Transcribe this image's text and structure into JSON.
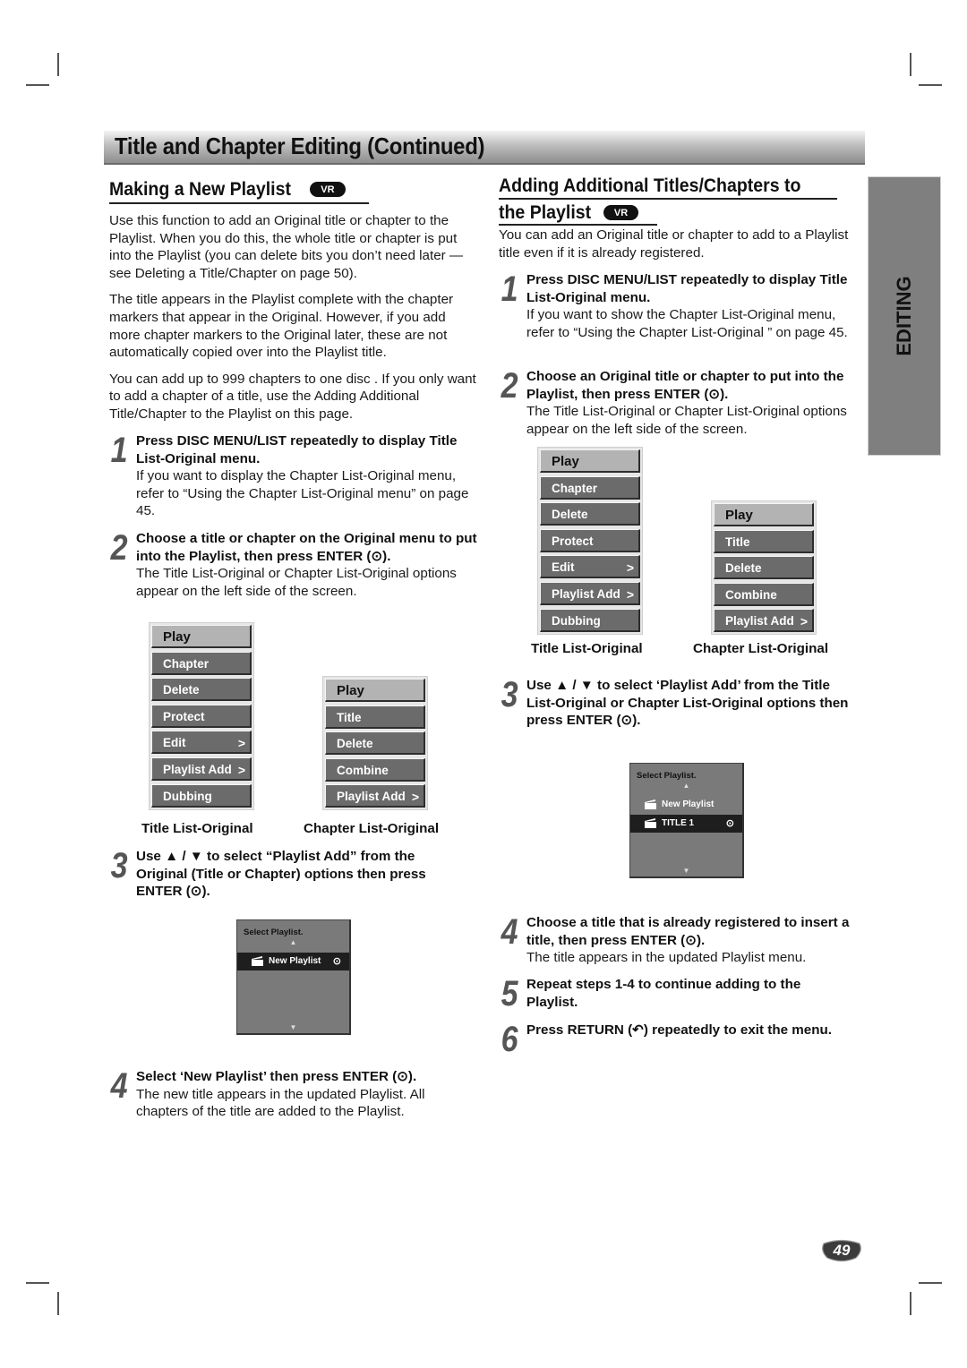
{
  "page": {
    "banner_title": "Title and Chapter Editing (Continued)",
    "side_tab": "EDITING",
    "page_number": "49"
  },
  "left": {
    "heading": "Making a New Playlist",
    "badge": "VR",
    "paragraphs": [
      "Use this function to add an Original title or chapter to the Playlist. When you do this, the whole title or chapter is put into the Playlist (you can delete bits you don’t need later — see Deleting a Title/Chapter on page 50).",
      "The title appears in the Playlist complete with the chapter markers that appear in the Original. However, if you add more chapter markers to the Original later, these are not automatically copied over into the Playlist title.",
      "You can add up to 999 chapters to one disc . If you only want to add a chapter of a title, use the Adding Additional Title/Chapter to the Playlist on this page."
    ],
    "steps": [
      {
        "num": "1",
        "bold": "Press DISC MENU/LIST repeatedly to display Title List-Original menu.",
        "normal": "If you want to display the Chapter List-Original menu, refer to “Using the Chapter List-Original menu” on page 45."
      },
      {
        "num": "2",
        "bold": "Choose a title or chapter on the Original menu to put into the Playlist, then press ENTER (⊙).",
        "normal": "The Title List-Original or Chapter List-Original options appear on the left side of the screen."
      },
      {
        "num": "3",
        "bold": "Use ▲ / ▼ to select “Playlist Add” from the Original (Title or Chapter) options then press ENTER (⊙).",
        "normal": ""
      },
      {
        "num": "4",
        "bold": "Select ‘New Playlist’ then press ENTER (⊙).",
        "normal": "The new title appears in the updated Playlist. All chapters of the title are added to the Playlist."
      }
    ],
    "title_menu": {
      "caption": "Title List-Original",
      "items": [
        "Play",
        "Chapter",
        "Delete",
        "Protect",
        "Edit",
        "Playlist Add",
        "Dubbing"
      ],
      "submenu_items": [
        "Edit",
        "Playlist Add"
      ]
    },
    "chapter_menu": {
      "caption": "Chapter List-Original",
      "items": [
        "Play",
        "Title",
        "Delete",
        "Combine",
        "Playlist Add"
      ],
      "submenu_items": [
        "Playlist Add"
      ]
    },
    "playlist_box": {
      "header": "Select Playlist.",
      "rows": [
        {
          "label": "New Playlist",
          "selected": true
        }
      ]
    }
  },
  "right": {
    "heading_line1": "Adding Additional Titles/Chapters to",
    "heading_line2": "the Playlist",
    "badge": "VR",
    "intro": "You can add an Original title or chapter to add to a Playlist title even if it is already registered.",
    "steps": [
      {
        "num": "1",
        "bold": "Press DISC MENU/LIST repeatedly to display Title List-Original menu.",
        "normal": "If you want to show the Chapter List-Original menu, refer to “Using the Chapter List-Original ” on page 45."
      },
      {
        "num": "2",
        "bold": "Choose an Original title or chapter to put into the Playlist, then press ENTER (⊙).",
        "normal": "The Title List-Original or Chapter List-Original options appear on the left side of the screen."
      },
      {
        "num": "3",
        "bold": "Use ▲ / ▼ to select ‘Playlist Add’ from the Title List-Original or Chapter List-Original options then press ENTER (⊙).",
        "normal": ""
      },
      {
        "num": "4",
        "bold": "Choose a title that is already registered to insert a title, then press ENTER (⊙).",
        "normal": "The title appears in the updated Playlist menu."
      },
      {
        "num": "5",
        "bold": "Repeat steps 1-4 to continue adding to the Playlist.",
        "normal": ""
      },
      {
        "num": "6",
        "bold": "Press RETURN (↶) repeatedly to exit the menu.",
        "normal": ""
      }
    ],
    "title_menu": {
      "caption": "Title List-Original",
      "items": [
        "Play",
        "Chapter",
        "Delete",
        "Protect",
        "Edit",
        "Playlist Add",
        "Dubbing"
      ],
      "submenu_items": [
        "Edit",
        "Playlist Add"
      ]
    },
    "chapter_menu": {
      "caption": "Chapter List-Original",
      "items": [
        "Play",
        "Title",
        "Delete",
        "Combine",
        "Playlist Add"
      ],
      "submenu_items": [
        "Playlist Add"
      ]
    },
    "playlist_box": {
      "header": "Select Playlist.",
      "rows": [
        {
          "label": "New Playlist",
          "selected": false
        },
        {
          "label": "TITLE 1",
          "selected": true
        }
      ]
    }
  },
  "glyphs": {
    "chevron": ">",
    "enter": "⊙",
    "arrow_up": "▲",
    "arrow_down": "▼"
  }
}
